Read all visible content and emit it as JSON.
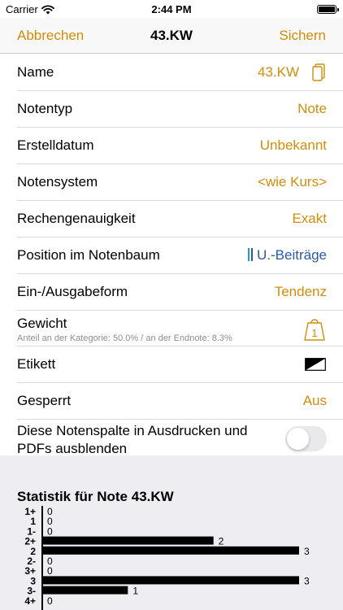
{
  "status_bar": {
    "carrier": "Carrier",
    "time": "2:44 PM"
  },
  "nav": {
    "cancel": "Abbrechen",
    "title": "43.KW",
    "save": "Sichern"
  },
  "rows": {
    "name": {
      "label": "Name",
      "value": "43.KW"
    },
    "type": {
      "label": "Notentyp",
      "value": "Note"
    },
    "created": {
      "label": "Erstelldatum",
      "value": "Unbekannt"
    },
    "system": {
      "label": "Notensystem",
      "value": "<wie Kurs>"
    },
    "precision": {
      "label": "Rechengenauigkeit",
      "value": "Exakt"
    },
    "tree": {
      "label": "Position im Notenbaum",
      "value": "U.-Beiträge"
    },
    "io": {
      "label": "Ein-/Ausgabeform",
      "value": "Tendenz"
    },
    "weight": {
      "label": "Gewicht",
      "sub": "Anteil an der Kategorie: 50.0% / an der Endnote: 8.3%",
      "icon_value": "1"
    },
    "label": {
      "label": "Etikett"
    },
    "locked": {
      "label": "Gesperrt",
      "value": "Aus"
    },
    "hide": {
      "label": "Diese Notenspalte in Ausdrucken und PDFs ausblenden",
      "toggle_on": false
    }
  },
  "colors": {
    "accent": "#d18d0a",
    "tree_blue": "#2a5aa8",
    "teal": "#19a3b8"
  },
  "stats": {
    "title": "Statistik für Note 43.KW"
  },
  "chart_data": {
    "type": "bar",
    "orientation": "horizontal",
    "categories": [
      "1+",
      "1",
      "1-",
      "2+",
      "2",
      "2-",
      "3+",
      "3",
      "3-",
      "4+"
    ],
    "values": [
      0,
      0,
      0,
      2,
      3,
      0,
      0,
      3,
      1,
      0
    ],
    "xlim": [
      0,
      3
    ]
  }
}
